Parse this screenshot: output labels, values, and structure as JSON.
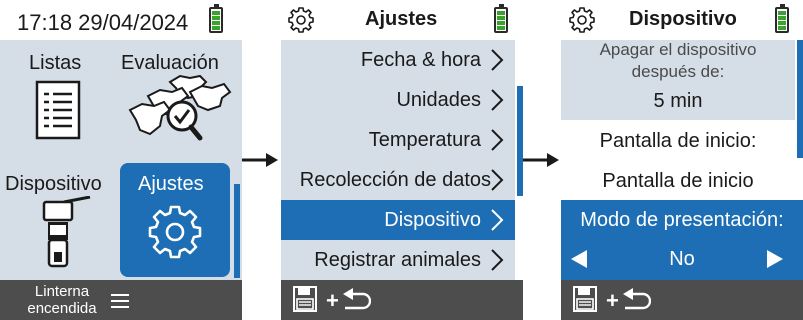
{
  "screen1": {
    "time": "17:18 29/04/2024",
    "tiles": [
      {
        "label": "Listas",
        "icon": "document-list-icon"
      },
      {
        "label": "Evaluación",
        "icon": "cows-evaluation-icon"
      },
      {
        "label": "Dispositivo",
        "icon": "handheld-reader-icon"
      },
      {
        "label": "Ajustes",
        "icon": "gear-icon"
      }
    ],
    "footer_label": "Linterna encendida",
    "menu_icon": "hamburger-menu-icon"
  },
  "screen2": {
    "title": "Ajustes",
    "menu": [
      "Fecha & hora",
      "Unidades",
      "Temperatura",
      "Recolección de datos",
      "Dispositivo",
      "Registrar animales"
    ],
    "selected_index": 4
  },
  "screen3": {
    "title": "Dispositivo",
    "power_off_label_line1": "Apagar el dispositivo",
    "power_off_label_line2": "después de:",
    "power_off_value": "5 min",
    "home_screen_label": "Pantalla de inicio:",
    "home_screen_value": "Pantalla de inicio",
    "presentation_mode_label": "Modo de presentación:",
    "presentation_mode_value": "No"
  },
  "footer": {
    "save_icon": "save-icon",
    "plus": "+",
    "back_icon": "back-arrow-icon"
  },
  "colors": {
    "accent": "#1d6eb4",
    "panel": "#d5dee7",
    "footer": "#4d4d4d",
    "battery": "#3aa32e"
  }
}
